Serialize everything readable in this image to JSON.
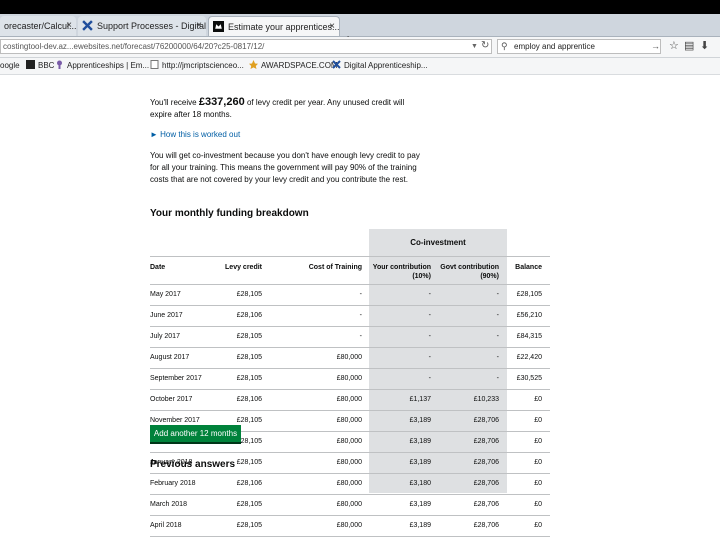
{
  "browser": {
    "tabs": [
      {
        "label": "orecaster/Calcul...",
        "close": "×",
        "icon": "",
        "active": false
      },
      {
        "label": "Support Processes - Digital...",
        "close": "×",
        "icon": "x-logo-icon",
        "active": false
      },
      {
        "label": "Estimate your apprentices...",
        "close": "×",
        "icon": "gov-crown-icon",
        "active": true
      }
    ],
    "new_tab": "+",
    "url": "costingtool-dev.az...ewebsites.net/forecast/76200000/64/20?c25-0817/12/",
    "search_value": "employ and apprentice",
    "bookmarks": [
      {
        "label": "oogle",
        "icon": ""
      },
      {
        "label": "BBC",
        "icon": "bbc-icon"
      },
      {
        "label": "Apprenticeships | Em...",
        "icon": "apprenticeships-icon"
      },
      {
        "label": "http://jmcriptscienceo...",
        "icon": "page-icon"
      },
      {
        "label": "AWARDSPACE.COM",
        "icon": "awardspace-icon"
      },
      {
        "label": "Digital Apprenticeship...",
        "icon": "x-logo-icon"
      }
    ]
  },
  "page": {
    "intro_before": "You'll receive ",
    "levy_amount": "£337,260",
    "intro_after_1": " of levy credit per year. Any unused credit will",
    "intro_after_2": "expire after 18 months.",
    "how_link": "► How this is worked out",
    "coinvest_lines": [
      "You will get co-investment because you don't have enough levy credit to pay",
      "for all your training. This means the government will pay 90% of the training",
      "costs that are not covered by your levy credit and you contribute the rest."
    ],
    "breakdown_title": "Your monthly funding breakdown",
    "table": {
      "group_header": "Co-investment",
      "headers": {
        "date": "Date",
        "levy": "Levy credit",
        "cost": "Cost of Training",
        "your_1": "Your contribution",
        "your_2": "(10%)",
        "govt_1": "Govt contribution",
        "govt_2": "(90%)",
        "balance": "Balance"
      },
      "rows": [
        {
          "date": "May 2017",
          "levy": "£28,105",
          "cost": "-",
          "your": "-",
          "govt": "-",
          "balance": "£28,105"
        },
        {
          "date": "June 2017",
          "levy": "£28,106",
          "cost": "-",
          "your": "-",
          "govt": "-",
          "balance": "£56,210"
        },
        {
          "date": "July 2017",
          "levy": "£28,105",
          "cost": "-",
          "your": "-",
          "govt": "-",
          "balance": "£84,315"
        },
        {
          "date": "August 2017",
          "levy": "£28,105",
          "cost": "£80,000",
          "your": "-",
          "govt": "-",
          "balance": "£22,420"
        },
        {
          "date": "September 2017",
          "levy": "£28,105",
          "cost": "£80,000",
          "your": "-",
          "govt": "-",
          "balance": "£30,525"
        },
        {
          "date": "October 2017",
          "levy": "£28,106",
          "cost": "£80,000",
          "your": "£1,137",
          "govt": "£10,233",
          "balance": "£0"
        },
        {
          "date": "November 2017",
          "levy": "£28,105",
          "cost": "£80,000",
          "your": "£3,189",
          "govt": "£28,706",
          "balance": "£0"
        },
        {
          "date": "December 2017",
          "levy": "£28,105",
          "cost": "£80,000",
          "your": "£3,189",
          "govt": "£28,706",
          "balance": "£0"
        },
        {
          "date": "January 2018",
          "levy": "£28,105",
          "cost": "£80,000",
          "your": "£3,189",
          "govt": "£28,706",
          "balance": "£0"
        },
        {
          "date": "February 2018",
          "levy": "£28,106",
          "cost": "£80,000",
          "your": "£3,180",
          "govt": "£28,706",
          "balance": "£0"
        },
        {
          "date": "March 2018",
          "levy": "£28,105",
          "cost": "£80,000",
          "your": "£3,189",
          "govt": "£28,706",
          "balance": "£0"
        },
        {
          "date": "April 2018",
          "levy": "£28,105",
          "cost": "£80,000",
          "your": "£3,189",
          "govt": "£28,706",
          "balance": "£0"
        }
      ]
    },
    "add_button": "Add another 12 months",
    "previous_answers": "Previous answers"
  },
  "colors": {
    "button_green": "#00823b",
    "link_blue": "#005ea5",
    "coinvestment_grey": "#dee0e2"
  }
}
